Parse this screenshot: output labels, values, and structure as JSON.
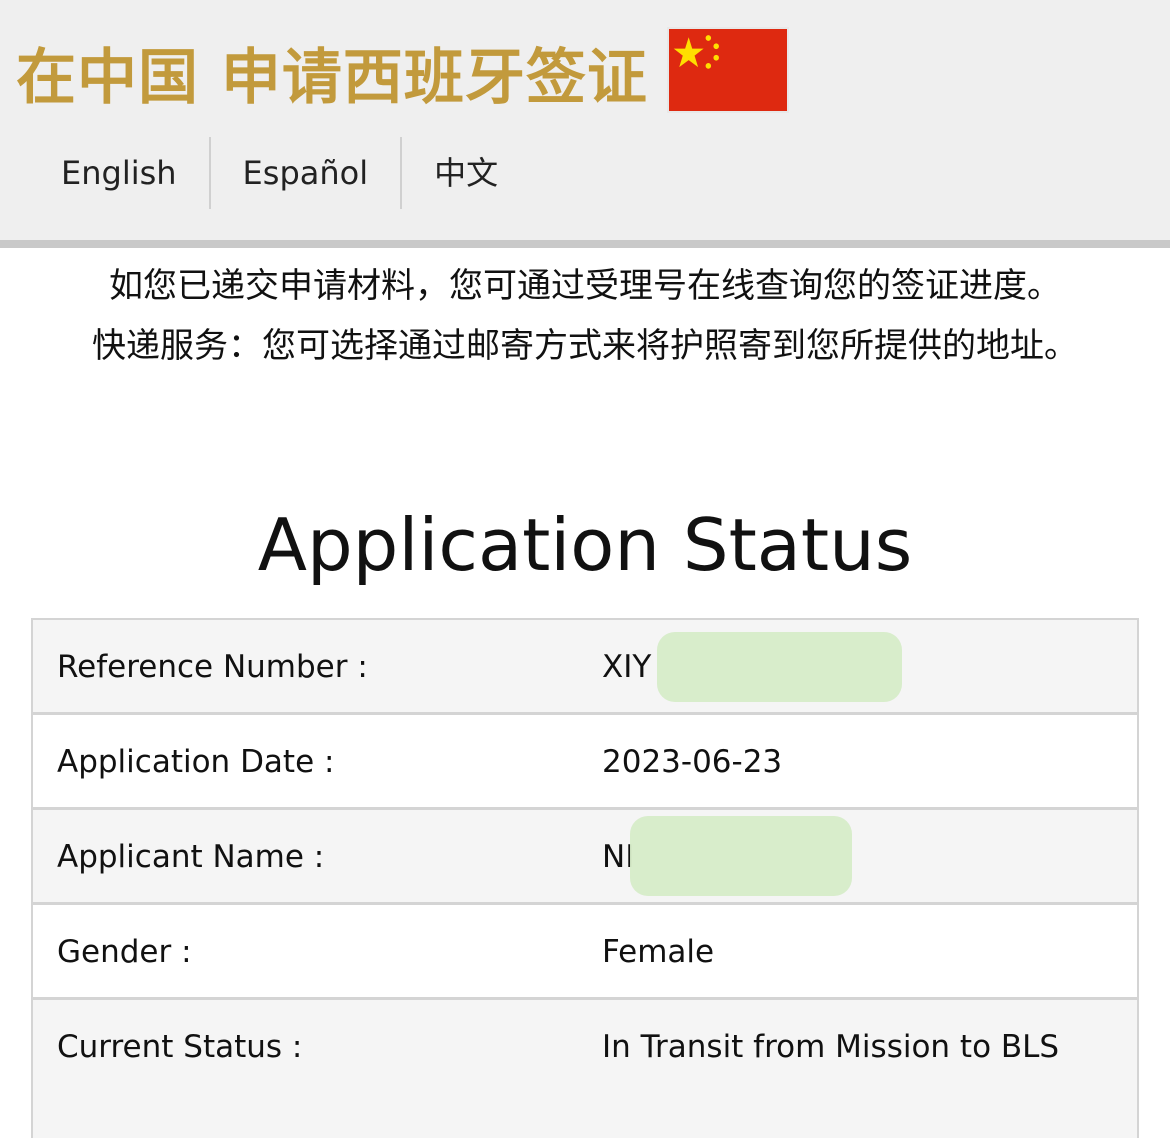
{
  "header": {
    "title": "在中国 申请西班牙签证",
    "flag_icon": "china-flag-icon",
    "flag_color": "#de2910",
    "star_color": "#ffde00",
    "languages": [
      {
        "label": "English"
      },
      {
        "label": "Español"
      },
      {
        "label": "中文"
      }
    ]
  },
  "intro": {
    "line1": "如您已递交申请材料，您可通过受理号在线查询您的签证进度。",
    "line2": "快递服务：您可选择通过邮寄方式来将护照寄到您所提供的地址。"
  },
  "status": {
    "heading": "Application Status",
    "rows": [
      {
        "label": "Reference Number :",
        "value": "XIY"
      },
      {
        "label": "Application Date :",
        "value": "2023-06-23"
      },
      {
        "label": "Applicant Name :",
        "value": "NI"
      },
      {
        "label": "Gender :",
        "value": "Female"
      },
      {
        "label": "Current Status :",
        "value": "In Transit from Mission to BLS"
      }
    ]
  },
  "colors": {
    "title_gold": "#c29a3c",
    "redaction_green": "#d6ecc8"
  }
}
